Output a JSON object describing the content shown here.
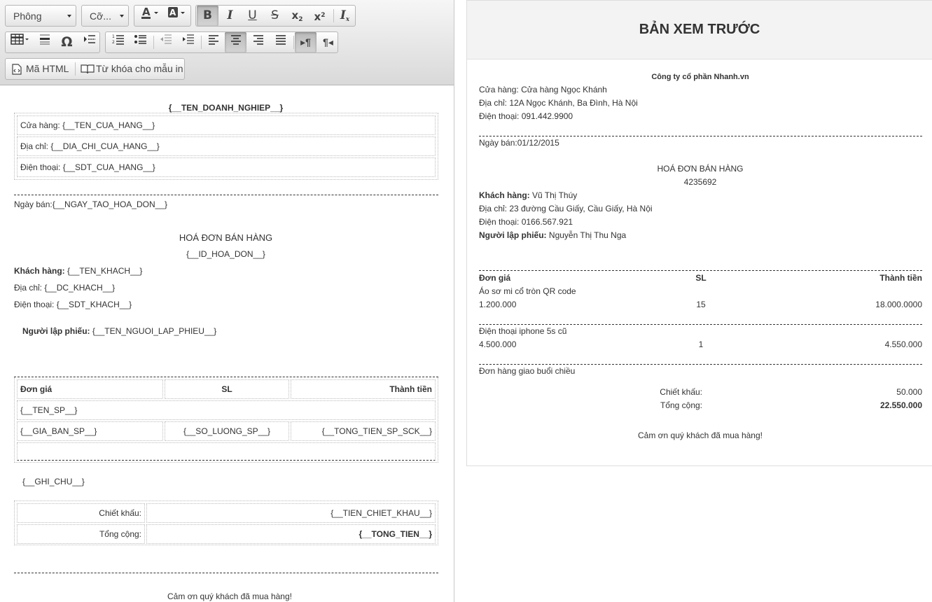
{
  "toolbar": {
    "font_combo": "Phông",
    "size_combo": "Cỡ...",
    "html_source_label": "Mã HTML",
    "keywords_label": "Từ khóa cho mẫu in"
  },
  "editor": {
    "company": "{__TEN_DOANH_NGHIEP__}",
    "store_rows": [
      "Cửa hàng: {__TEN_CUA_HANG__}",
      "Địa chỉ: {__DIA_CHI_CUA_HANG__}",
      "Điện thoại: {__SDT_CUA_HANG__}"
    ],
    "sale_date": "Ngày bán:{__NGAY_TAO_HOA_DON__}",
    "invoice_title": "HOÁ ĐƠN BÁN HÀNG",
    "invoice_id": "{__ID_HOA_DON__}",
    "customer_label": "Khách hàng:",
    "customer_value": " {__TEN_KHACH__}",
    "address": "Địa chỉ: {__DC_KHACH__}",
    "phone": "Điện thoại: {__SDT_KHACH__}",
    "creator_label": "Người lập phiếu:",
    "creator_value": " {__TEN_NGUOI_LAP_PHIEU__}",
    "table_headers": [
      "Đơn giá",
      "SL",
      "Thành tiền"
    ],
    "product_name": "{__TEN_SP__}",
    "product_row": [
      "{__GIA_BAN_SP__}",
      "{__SO_LUONG_SP__}",
      "{__TONG_TIEN_SP_SCK__}"
    ],
    "note": "{__GHI_CHU__}",
    "discount_label": "Chiết khấu:",
    "discount_value": "{__TIEN_CHIET_KHAU__}",
    "total_label": "Tổng cộng:",
    "total_value": "{__TONG_TIEN__}",
    "thanks": "Cảm ơn quý khách đã mua hàng!"
  },
  "preview": {
    "heading": "BẢN XEM TRƯỚC",
    "company": "Công ty cổ phần Nhanh.vn",
    "store": "Cửa hàng: Cửa hàng Ngọc Khánh",
    "store_address": "Địa chỉ: 12A Ngọc Khánh, Ba Đình, Hà Nội",
    "store_phone": "Điện thoại: 091.442.9900",
    "sale_date": "Ngày bán:01/12/2015",
    "invoice_title": "HOÁ ĐƠN BÁN HÀNG",
    "invoice_id": "4235692",
    "customer_label": "Khách hàng:",
    "customer_value": " Vũ Thị Thúy",
    "address": "Địa chỉ: 23 đường Cầu Giấy, Cầu Giấy, Hà Nội",
    "phone": "Điện thoại: 0166.567.921",
    "creator_label": "Người lập phiếu:",
    "creator_value": " Nguyễn Thị Thu Nga",
    "table_headers": [
      "Đơn giá",
      "SL",
      "Thành tiền"
    ],
    "items": [
      {
        "name": "Áo sơ mi cổ tròn QR code",
        "price": "1.200.000",
        "qty": "15",
        "total": "18.000.0000"
      },
      {
        "name": "Điện thoại iphone 5s cũ",
        "price": "4.500.000",
        "qty": "1",
        "total": "4.550.000"
      }
    ],
    "note": "Đơn hàng giao buổi chiều",
    "discount_label": "Chiết khấu:",
    "discount_value": "50.000",
    "total_label": "Tổng cộng:",
    "total_value": "22.550.000",
    "thanks": "Cảm ơn quý khách đã mua hàng!"
  }
}
